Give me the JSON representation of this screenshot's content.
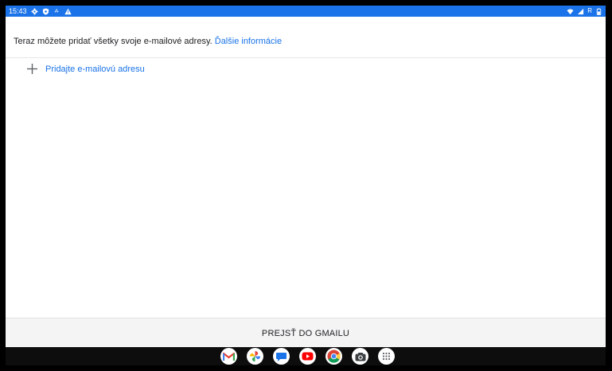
{
  "status_bar": {
    "time": "15:43",
    "left_icons": [
      "settings-gear-icon",
      "shield-icon",
      "dots-icon",
      "warning-icon"
    ],
    "right_icons": [
      "wifi-icon",
      "signal-icon",
      "battery-icon"
    ],
    "right_text": "R",
    "background": "#1a73e8"
  },
  "info": {
    "text": "Teraz môžete pridať všetky svoje e-mailové adresy.",
    "link": "Ďalšie informácie"
  },
  "add_email": {
    "label": "Pridajte e-mailovú adresu"
  },
  "footer": {
    "button_label": "PREJSŤ DO GMAILU"
  },
  "dock": {
    "apps": [
      "gmail-icon",
      "photos-pinwheel-icon",
      "messages-icon",
      "youtube-icon",
      "chrome-icon",
      "camera-icon",
      "app-launcher-icon"
    ]
  },
  "colors": {
    "accent": "#1a73e8",
    "text": "#202124",
    "footer_bg": "#f4f4f4"
  }
}
